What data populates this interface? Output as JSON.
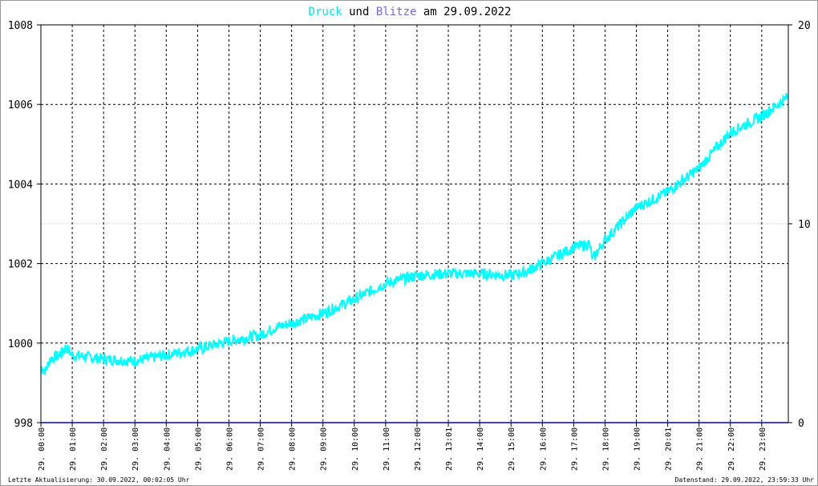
{
  "chart_data": {
    "type": "line",
    "title": {
      "part1": "Druck",
      "part2": " und ",
      "part3": "Blitze",
      "part4": " am 29.09.2022"
    },
    "colors": {
      "pressure": "#00ffff",
      "lightning": "#7766dd",
      "grid": "#000000"
    },
    "y_left": {
      "range": [
        998,
        1008
      ],
      "ticks": [
        "998",
        "1000",
        "1002",
        "1004",
        "1006",
        "1008"
      ]
    },
    "y_right": {
      "range": [
        0,
        20
      ],
      "ticks": [
        "0",
        "10",
        "20"
      ]
    },
    "x_range_hours": [
      0,
      23.85
    ],
    "x_ticks": [
      "29. 00:00",
      "29. 01:00",
      "29. 02:00",
      "29. 03:00",
      "29. 04:00",
      "29. 05:00",
      "29. 06:00",
      "29. 07:00",
      "29. 08:00",
      "29. 09:00",
      "29. 10:00",
      "29. 11:00",
      "29. 12:00",
      "29. 13:01",
      "29. 14:00",
      "29. 15:00",
      "29. 16:00",
      "29. 17:00",
      "29. 18:00",
      "29. 19:00",
      "29. 20:01",
      "29. 21:00",
      "29. 22:00",
      "29. 23:00"
    ],
    "series": [
      {
        "name": "Druck",
        "axis": "left",
        "points_hour_hpa": [
          [
            0,
            999.4
          ],
          [
            0.15,
            999.3
          ],
          [
            0.3,
            999.6
          ],
          [
            0.6,
            999.7
          ],
          [
            0.8,
            999.9
          ],
          [
            1,
            999.7
          ],
          [
            2,
            999.6
          ],
          [
            3,
            999.55
          ],
          [
            4,
            999.7
          ],
          [
            5,
            999.85
          ],
          [
            6,
            1000.05
          ],
          [
            7,
            1000.2
          ],
          [
            7.5,
            1000.4
          ],
          [
            8,
            1000.5
          ],
          [
            9,
            1000.75
          ],
          [
            10,
            1001.1
          ],
          [
            11,
            1001.5
          ],
          [
            12,
            1001.7
          ],
          [
            13,
            1001.75
          ],
          [
            14,
            1001.75
          ],
          [
            15,
            1001.7
          ],
          [
            15.5,
            1001.8
          ],
          [
            16,
            1002.0
          ],
          [
            17,
            1002.4
          ],
          [
            17.5,
            1002.5
          ],
          [
            17.6,
            1002.1
          ],
          [
            18,
            1002.6
          ],
          [
            19,
            1003.4
          ],
          [
            20,
            1003.8
          ],
          [
            21,
            1004.4
          ],
          [
            22,
            1005.3
          ],
          [
            23,
            1005.7
          ],
          [
            23.85,
            1006.2
          ]
        ]
      },
      {
        "name": "Blitze",
        "axis": "right",
        "points_hour_count": [
          [
            0,
            0
          ],
          [
            23.85,
            0
          ]
        ]
      }
    ]
  },
  "footer": {
    "left": "Letzte Aktualisierung: 30.09.2022, 00:02:05 Uhr",
    "right": "Datenstand: 29.09.2022, 23:59:33 Uhr"
  }
}
